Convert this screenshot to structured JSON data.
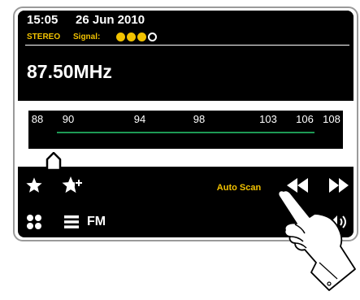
{
  "status_bar": {
    "time": "15:05",
    "date": "26 Jun 2010"
  },
  "indicators": {
    "stereo_label": "STEREO",
    "signal_label": "Signal:",
    "signal_strength_of_4": 3
  },
  "frequency": "87.50MHz",
  "tuner": {
    "scale_labels": [
      "88",
      "90",
      "94",
      "98",
      "103",
      "106",
      "108"
    ],
    "needle_at_mhz": 87.5
  },
  "buttons": {
    "auto_scan_label": "Auto Scan",
    "source_label": "FM"
  },
  "icons": [
    "star-icon",
    "star-plus-icon",
    "rewind-icon",
    "fast-forward-icon",
    "grid-menu-icon",
    "list-menu-icon",
    "volume-icon",
    "pointing-hand-icon"
  ],
  "colors": {
    "accent": "#f2c200",
    "band": "#1e9a55",
    "screen": "#000000",
    "text": "#ffffff"
  }
}
